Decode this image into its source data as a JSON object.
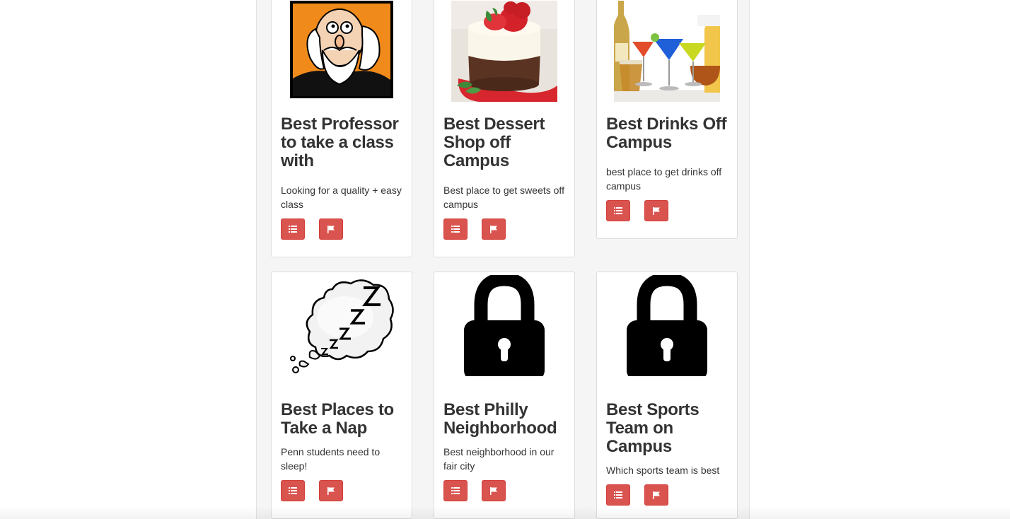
{
  "cards": [
    {
      "title": "Best Professor to take a class with",
      "description": "Looking for a quality + easy class",
      "image": "professor-cartoon-image"
    },
    {
      "title": "Best Dessert Shop off Campus",
      "description": "Best place to get sweets off campus",
      "image": "cheesecake-image"
    },
    {
      "title": "Best Drinks Off Campus",
      "description": "best place to get drinks off campus",
      "image": "cocktails-image"
    },
    {
      "title": "Best Places to Take a Nap",
      "description": "Penn students need to sleep!",
      "image": "sleep-cloud-image"
    },
    {
      "title": "Best Philly Neighborhood",
      "description": "Best neighborhood in our fair city",
      "image": "lock-icon"
    },
    {
      "title": "Best Sports Team on Campus",
      "description": "Which sports team is best",
      "image": "lock-icon"
    }
  ],
  "icons": {
    "list": "list-icon",
    "flag": "flag-icon"
  },
  "colors": {
    "button": "#d9534f",
    "button_border": "#d43f3a",
    "panel": "#f5f5f5",
    "card_border": "#dddddd",
    "text": "#333333"
  }
}
